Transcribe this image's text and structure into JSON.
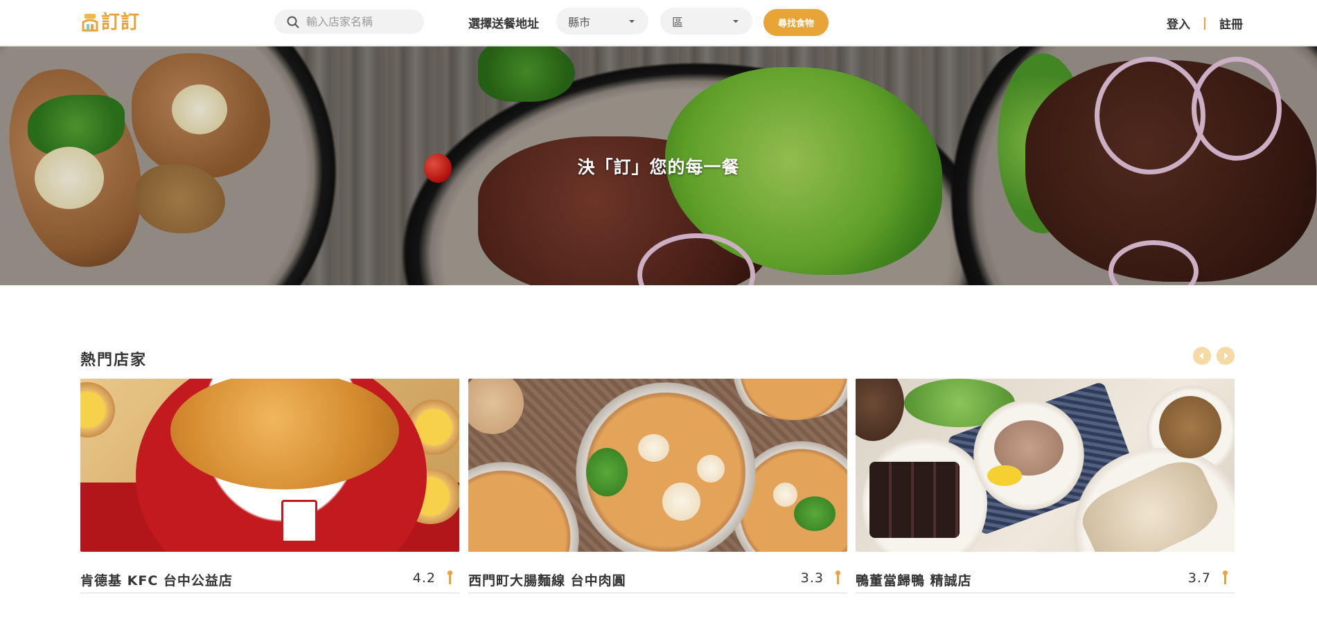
{
  "header": {
    "logo_text": "訂訂",
    "search_placeholder": "輸入店家名稱",
    "address_label": "選擇送餐地址",
    "city_select": "縣市",
    "district_select": "區",
    "find_button": "尋找食物",
    "login": "登入",
    "register": "註冊"
  },
  "hero": {
    "title": "決「訂」您的每一餐"
  },
  "popular": {
    "title": "熱門店家",
    "stores": [
      {
        "name": "肯德基 KFC 台中公益店",
        "rating": "4.2"
      },
      {
        "name": "西門町大腸麵線 台中肉圓",
        "rating": "3.3"
      },
      {
        "name": "鴨董當歸鴨 精誠店",
        "rating": "3.7"
      }
    ]
  },
  "colors": {
    "accent": "#e8a436",
    "arrow_bg": "#f6d9a3",
    "text": "#333333"
  },
  "icons": {
    "search": "search-icon",
    "rating": "pin-icon",
    "prev": "chevron-left-icon",
    "next": "chevron-right-icon"
  }
}
